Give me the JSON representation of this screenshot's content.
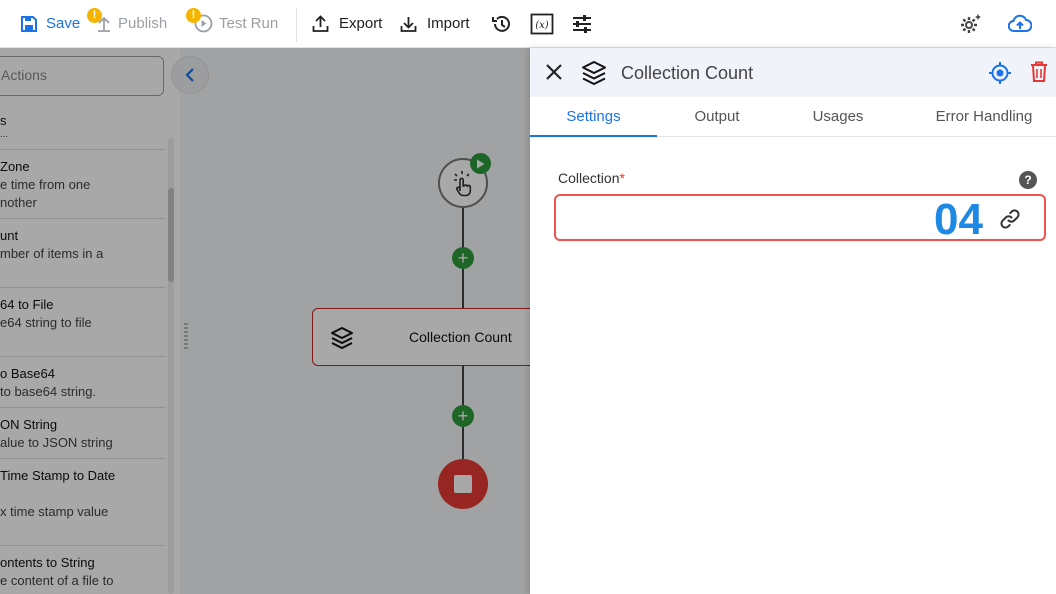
{
  "toolbar": {
    "save": "Save",
    "publish": "Publish",
    "test_run": "Test Run",
    "export": "Export",
    "import": "Import",
    "warning_badge": "!"
  },
  "left_panel": {
    "search_placeholder": "Actions",
    "items": [
      {
        "title": "s",
        "desc": "..."
      },
      {
        "title": "Zone",
        "desc": "e time from one",
        "desc2": "nother"
      },
      {
        "title": "unt",
        "desc": "mber of items in a",
        "desc2": ""
      },
      {
        "title": "64 to File",
        "desc": "e64 string to file",
        "desc2": ""
      },
      {
        "title": "o Base64",
        "desc": "to base64 string."
      },
      {
        "title": "ON String",
        "desc": "alue to JSON string"
      },
      {
        "title": "Time Stamp to Date",
        "desc": "",
        "desc2": "x time stamp value"
      },
      {
        "title": "ontents to String",
        "desc": "e content of a file to"
      }
    ]
  },
  "canvas": {
    "node_label": "Collection Count",
    "plus": "+"
  },
  "right_panel": {
    "title": "Collection Count",
    "tabs": [
      "Settings",
      "Output",
      "Usages",
      "Error Handling"
    ],
    "field_label": "Collection",
    "required_mark": "*",
    "help": "?",
    "field_value": "04"
  },
  "colors": {
    "accent": "#1a73e8",
    "error": "#e53935",
    "success": "#2e9b3e",
    "warning": "#f5b400"
  }
}
